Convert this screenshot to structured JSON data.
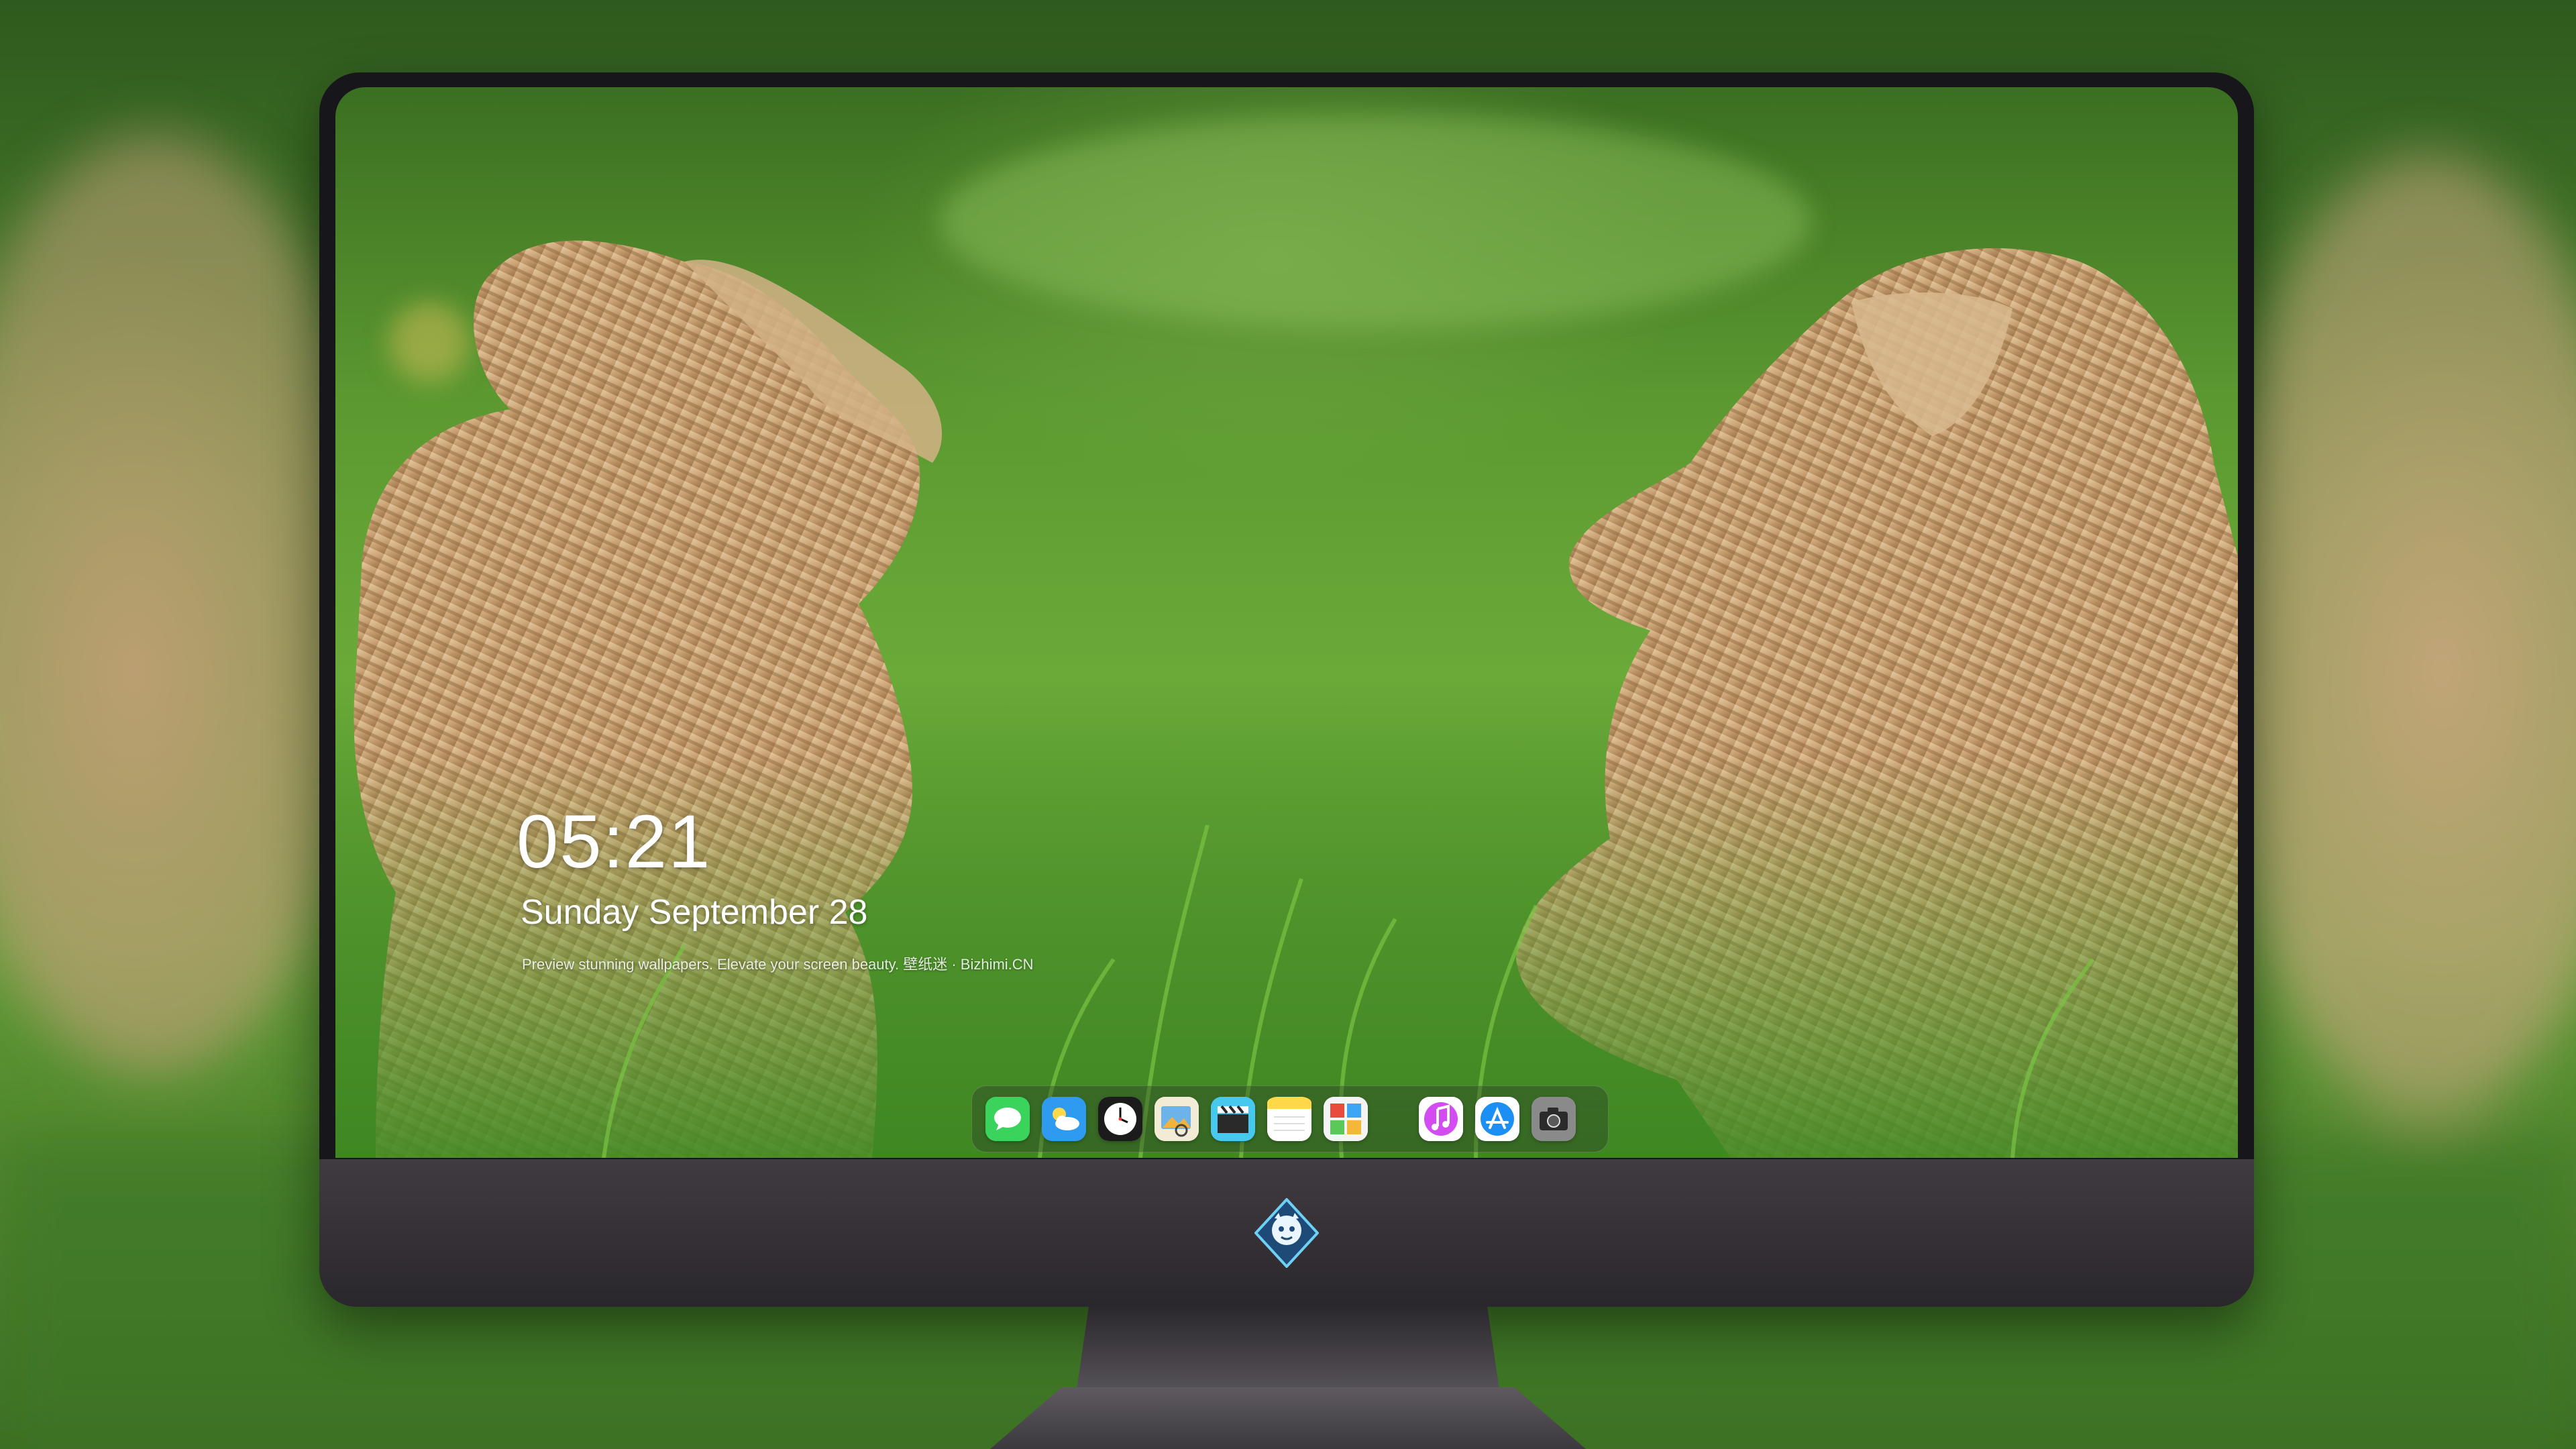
{
  "lockscreen": {
    "time": "05:21",
    "date": "Sunday September  28",
    "tagline": "Preview stunning wallpapers. Elevate your screen beauty. 壁纸迷 · Bizhimi.CN"
  },
  "dock": {
    "apps": [
      {
        "name": "messages",
        "icon": "chat-bubble-icon",
        "color": "#36d058"
      },
      {
        "name": "weather",
        "icon": "cloud-sun-icon",
        "color": "#2f9bf0"
      },
      {
        "name": "clock",
        "icon": "clock-icon",
        "color": "#ffffff"
      },
      {
        "name": "preview",
        "icon": "image-viewer-icon",
        "color": "#e9e2c8"
      },
      {
        "name": "clips",
        "icon": "clapperboard-icon",
        "color": "#3fc2e8"
      },
      {
        "name": "notes",
        "icon": "notepad-icon",
        "color": "#ffd94a"
      },
      {
        "name": "photo-booth",
        "icon": "photo-grid-icon",
        "color": "#f4f4f4"
      },
      {
        "name": "music",
        "icon": "music-note-icon",
        "color": "#c43cf0"
      },
      {
        "name": "app-store",
        "icon": "app-store-icon",
        "color": "#1c8ff5"
      },
      {
        "name": "camera",
        "icon": "camera-icon",
        "color": "#7a7a7a"
      }
    ]
  }
}
